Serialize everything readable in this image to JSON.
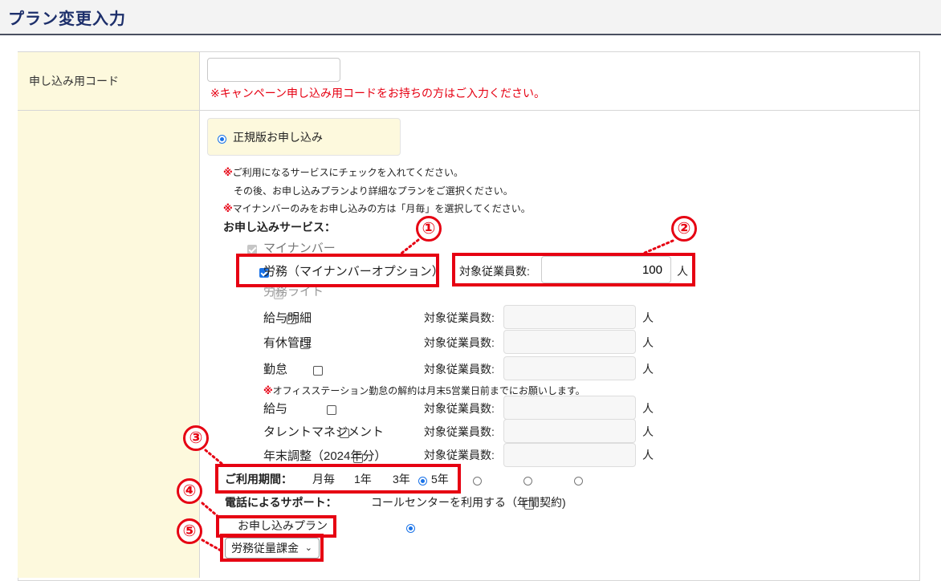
{
  "header": {
    "title": "プラン変更入力"
  },
  "campaign": {
    "label": "申し込み用コード",
    "value": "",
    "note": "※キャンペーン申し込み用コードをお持ちの方はご入力ください。"
  },
  "plan_type": {
    "label": "正規版お申し込み",
    "selected": true
  },
  "notes": {
    "mark": "※",
    "line1": "ご利用になるサービスにチェックを入れてください。",
    "line2": "その後、お申し込みプランより詳細なプランをご選択ください。",
    "line3": "マイナンバーのみをお申し込みの方は「月毎」を選択してください。"
  },
  "services": {
    "heading": "お申し込みサービス：",
    "count_label": "対象従業員数:",
    "unit": "人",
    "items": [
      {
        "label": "マイナンバー",
        "checked": true,
        "disabled": true
      },
      {
        "label": "労務（マイナンバーオプション）",
        "checked": true,
        "disabled": false,
        "count": "100"
      },
      {
        "label": "労務ライト",
        "checked": false,
        "disabled": true
      },
      {
        "label": "給与明細",
        "checked": false,
        "disabled": false,
        "count": ""
      },
      {
        "label": "有休管理",
        "checked": false,
        "disabled": false,
        "count": ""
      },
      {
        "label": "勤怠",
        "checked": false,
        "disabled": false,
        "count": ""
      },
      {
        "label": "給与",
        "checked": false,
        "disabled": false,
        "count": ""
      },
      {
        "label": "タレントマネジメント",
        "checked": false,
        "disabled": false,
        "count": ""
      },
      {
        "label": "年末調整（2024年分）",
        "checked": false,
        "disabled": false,
        "count": ""
      }
    ],
    "kintai_note": "オフィスステーション勤怠の解約は月末5営業日前までにお願いします。"
  },
  "period": {
    "label": "ご利用期間：",
    "options": [
      "月毎",
      "1年",
      "3年",
      "5年"
    ],
    "selected": "月毎"
  },
  "support": {
    "label": "電話によるサポート：",
    "option": "コールセンターを利用する（年間契約)"
  },
  "apply_plan": {
    "label": "お申し込みプラン",
    "selected": true
  },
  "plan_select": {
    "value": "労務従量課金"
  },
  "markers": [
    "①",
    "②",
    "③",
    "④",
    "⑤"
  ],
  "colors": {
    "highlight": "#e60012",
    "accent": "#1a73e8",
    "label_bg": "#fdf9dd",
    "title": "#1d2f6b"
  }
}
